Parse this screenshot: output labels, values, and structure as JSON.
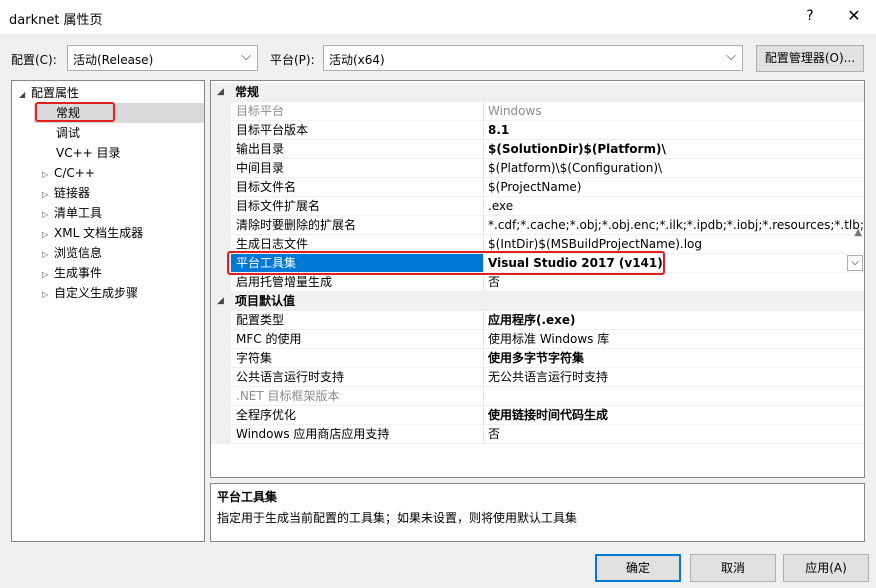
{
  "window": {
    "title": "darknet 属性页",
    "help": "?",
    "close": "✕"
  },
  "toolbar": {
    "config_label": "配置(C):",
    "config_value": "活动(Release)",
    "platform_label": "平台(P):",
    "platform_value": "活动(x64)",
    "config_manager": "配置管理器(O)..."
  },
  "tree": {
    "root": "配置属性",
    "items": [
      {
        "label": "常规"
      },
      {
        "label": "调试"
      },
      {
        "label": "VC++ 目录"
      },
      {
        "label": "C/C++"
      },
      {
        "label": "链接器"
      },
      {
        "label": "清单工具"
      },
      {
        "label": "XML 文档生成器"
      },
      {
        "label": "浏览信息"
      },
      {
        "label": "生成事件"
      },
      {
        "label": "自定义生成步骤"
      }
    ]
  },
  "grid": {
    "cat1": "常规",
    "rows1": [
      {
        "name": "目标平台",
        "value": "Windows"
      },
      {
        "name": "目标平台版本",
        "value": "8.1"
      },
      {
        "name": "输出目录",
        "value": "$(SolutionDir)$(Platform)\\"
      },
      {
        "name": "中间目录",
        "value": "$(Platform)\\$(Configuration)\\"
      },
      {
        "name": "目标文件名",
        "value": "$(ProjectName)"
      },
      {
        "name": "目标文件扩展名",
        "value": ".exe"
      },
      {
        "name": "清除时要删除的扩展名",
        "value": "*.cdf;*.cache;*.obj;*.obj.enc;*.ilk;*.ipdb;*.iobj;*.resources;*.tlb;*.tli;*.t"
      },
      {
        "name": "生成日志文件",
        "value": "$(IntDir)$(MSBuildProjectName).log"
      },
      {
        "name": "平台工具集",
        "value": "Visual Studio 2017 (v141)"
      },
      {
        "name": "启用托管增量生成",
        "value": "否"
      }
    ],
    "cat2": "项目默认值",
    "rows2": [
      {
        "name": "配置类型",
        "value": "应用程序(.exe)"
      },
      {
        "name": "MFC 的使用",
        "value": "使用标准 Windows 库"
      },
      {
        "name": "字符集",
        "value": "使用多字节字符集"
      },
      {
        "name": "公共语言运行时支持",
        "value": "无公共语言运行时支持"
      },
      {
        "name": ".NET 目标框架版本",
        "value": ""
      },
      {
        "name": "全程序优化",
        "value": "使用链接时间代码生成"
      },
      {
        "name": "Windows 应用商店应用支持",
        "value": "否"
      }
    ]
  },
  "description": {
    "title": "平台工具集",
    "text": "指定用于生成当前配置的工具集；如果未设置，则将使用默认工具集"
  },
  "buttons": {
    "ok": "确定",
    "cancel": "取消",
    "apply": "应用(A)"
  },
  "colors": {
    "selection": "#0078d7",
    "highlight_box": "#e02020"
  }
}
